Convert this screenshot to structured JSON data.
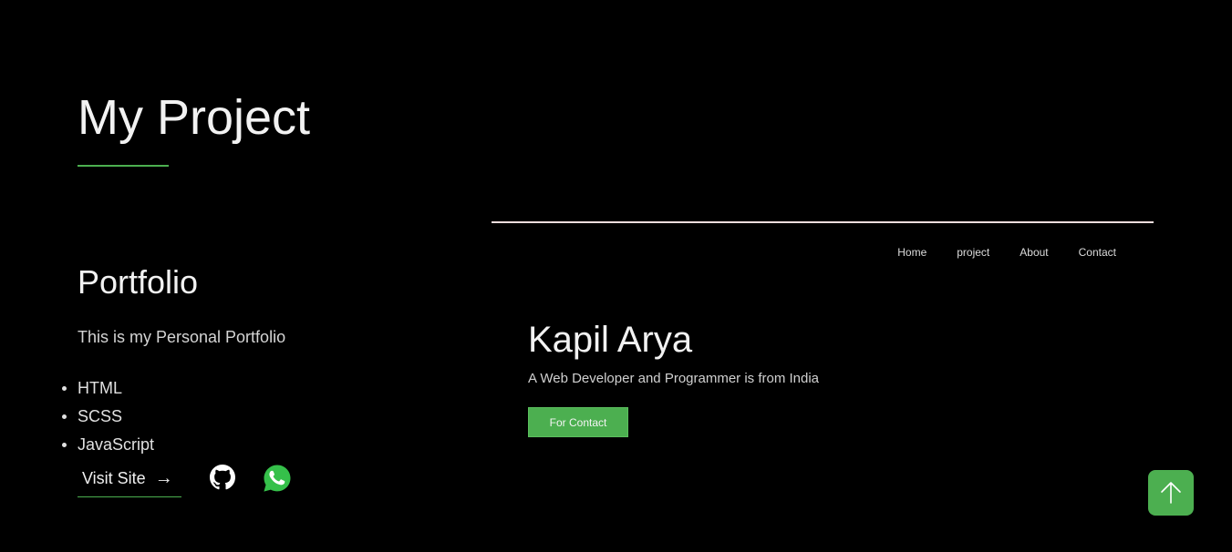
{
  "section": {
    "title": "My Project"
  },
  "project": {
    "name": "Portfolio",
    "description": "This is my Personal Portfolio",
    "technologies": [
      "HTML",
      "SCSS",
      "JavaScript"
    ],
    "visit_label": "Visit Site",
    "visit_arrow": "→",
    "github_icon": "github-icon",
    "whatsapp_icon": "whatsapp-icon"
  },
  "preview": {
    "nav": [
      "Home",
      "project",
      "About",
      "Contact"
    ],
    "hero_name": "Kapil Arya",
    "hero_tagline": "A Web Developer and Programmer is from India",
    "contact_button": "For Contact"
  },
  "scroll_top": {
    "icon": "arrow-up-icon"
  },
  "colors": {
    "background": "#000000",
    "accent": "#4caf50",
    "text": "#e8e8e8"
  }
}
